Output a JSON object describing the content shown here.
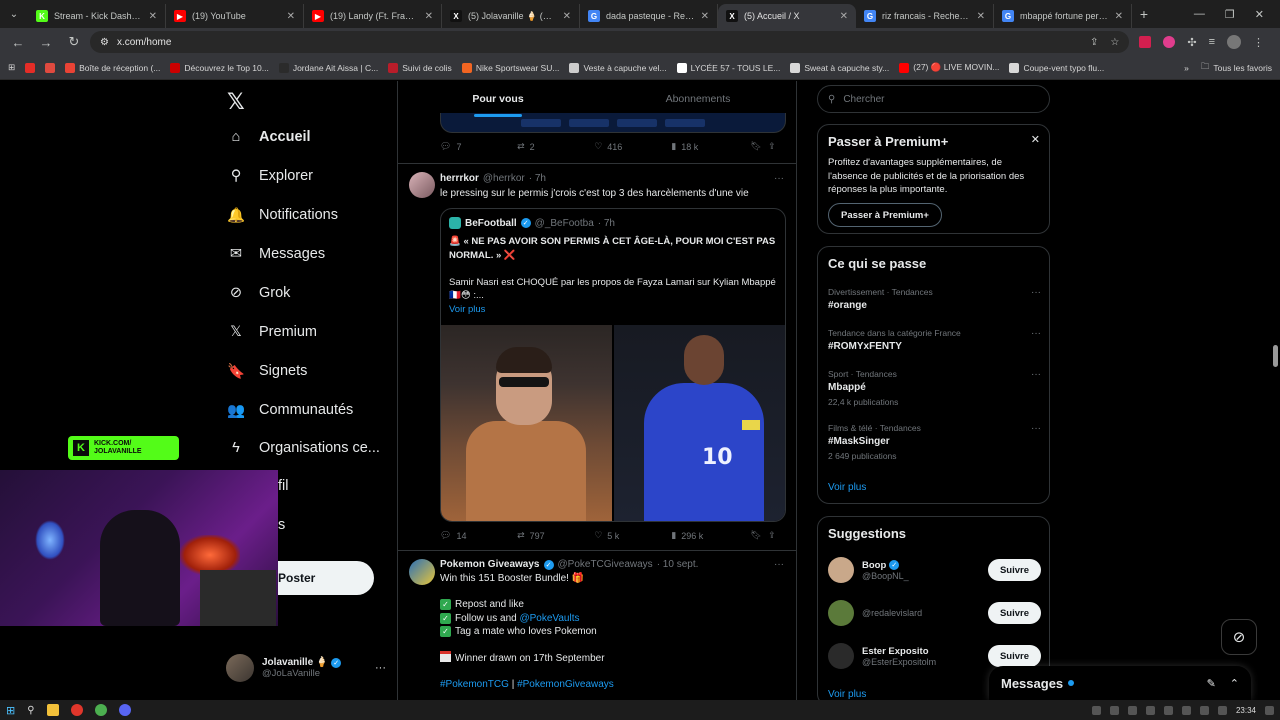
{
  "browser": {
    "tabs": [
      {
        "label": "Stream - Kick Dashboard",
        "fav": "K",
        "color": "#53fc18",
        "active": false
      },
      {
        "label": "(19) YouTube",
        "fav": "▶",
        "color": "#ff0000",
        "active": false
      },
      {
        "label": "(19) Landy (Ft. Franglish)",
        "fav": "▶",
        "color": "#ff0000",
        "active": false
      },
      {
        "label": "(5) Jolavanille 🍦 (@JoLaV",
        "fav": "X",
        "color": "#111111",
        "active": false
      },
      {
        "label": "dada pasteque - Recherch",
        "fav": "G",
        "color": "#4285f4",
        "active": false
      },
      {
        "label": "(5) Accueil / X",
        "fav": "X",
        "color": "#111111",
        "active": true
      },
      {
        "label": "riz francais - Recherche G",
        "fav": "G",
        "color": "#4285f4",
        "active": false
      },
      {
        "label": "mbappé fortune personn",
        "fav": "G",
        "color": "#4285f4",
        "active": false
      }
    ],
    "url": "x.com/home",
    "bookmarks": [
      {
        "label": "",
        "color": "#e52d27"
      },
      {
        "label": "",
        "color": "#e04a3f"
      },
      {
        "label": "Boîte de réception (...",
        "color": "#ea4335"
      },
      {
        "label": "Découvrez le Top 10...",
        "color": "#cc0000"
      },
      {
        "label": "Jordane Ait Aissa | C...",
        "color": "#2b2b2b"
      },
      {
        "label": "Suivi de colis",
        "color": "#b91d2a"
      },
      {
        "label": "Nike Sportswear SU...",
        "color": "#f26522"
      },
      {
        "label": "Veste à capuche vel...",
        "color": "#cccccc"
      },
      {
        "label": "LYCÉE 57 - TOUS LE...",
        "color": "#ffffff"
      },
      {
        "label": "Sweat à capuche sty...",
        "color": "#d8d8d8"
      },
      {
        "label": "(27) 🔴 LIVE MOVIN...",
        "color": "#ff0000"
      },
      {
        "label": "Coupe-vent typo flu...",
        "color": "#d8d8d8"
      }
    ],
    "bookmarks_all": "Tous les favoris"
  },
  "nav": {
    "items": [
      {
        "label": "Accueil",
        "icon": "home-icon",
        "glyph": "⌂",
        "bold": true,
        "badge": ""
      },
      {
        "label": "Explorer",
        "icon": "search-icon",
        "glyph": "⚲",
        "bold": false,
        "badge": ""
      },
      {
        "label": "Notifications",
        "icon": "bell-icon",
        "glyph": "🔔",
        "bold": false,
        "badge": "4"
      },
      {
        "label": "Messages",
        "icon": "mail-icon",
        "glyph": "✉",
        "bold": false,
        "badge": "1"
      },
      {
        "label": "Grok",
        "icon": "grok-icon",
        "glyph": "⊘",
        "bold": false,
        "badge": ""
      },
      {
        "label": "Premium",
        "icon": "x-logo-icon",
        "glyph": "𝕏",
        "bold": false,
        "badge": ""
      },
      {
        "label": "Signets",
        "icon": "bookmark-icon",
        "glyph": "🔖",
        "bold": false,
        "badge": ""
      },
      {
        "label": "Communautés",
        "icon": "communities-icon",
        "glyph": "👥",
        "bold": false,
        "badge": ""
      },
      {
        "label": "Organisations ce...",
        "icon": "lightning-icon",
        "glyph": "ϟ",
        "bold": false,
        "badge": ""
      },
      {
        "label": "fil",
        "icon": "profile-icon",
        "glyph": "",
        "bold": false,
        "badge": ""
      },
      {
        "label": "s",
        "icon": "more-icon",
        "glyph": "",
        "bold": false,
        "badge": ""
      }
    ],
    "post_label": "Poster",
    "user_name": "Jolavanille 🍦",
    "user_handle": "@JoLaVanille"
  },
  "kick_badge": {
    "line1": "KICK.COM/",
    "line2": "JOLAVANILLE"
  },
  "timeline": {
    "tabs": [
      "Pour vous",
      "Abonnements"
    ],
    "prev_actions": {
      "replies": "7",
      "reposts": "2",
      "likes": "416",
      "views": "18 k"
    },
    "tweet1": {
      "name": "herrrkor",
      "handle": "@herrkor",
      "time": "· 7h",
      "text": "le pressing sur le permis j'crois c'est top 3 des harcèlements d'une vie",
      "quote": {
        "name": "BeFootball",
        "handle": "@_BeFootba",
        "time": "· 7h",
        "line1": "🚨 « NE PAS AVOIR SON PERMIS À CET ÂGE-LÀ, POUR MOI C'EST PAS NORMAL. » ❌",
        "line2": "Samir Nasri est CHOQUÉ par les propos de Fayza Lamari sur Kylian Mbappé 🇫🇷😳 :...",
        "more": "Voir plus",
        "jersey_number": "10"
      },
      "actions": {
        "replies": "14",
        "reposts": "797",
        "likes": "5 k",
        "views": "296 k"
      }
    },
    "tweet2": {
      "name": "Pokemon Giveaways",
      "handle": "@PokeTCGiveaways",
      "time": "· 10 sept.",
      "title": "Win this 151 Booster Bundle! 🎁",
      "check1": "Repost and like",
      "check2_pre": "Follow us and ",
      "check2_link": "@PokeVaults",
      "check3": "Tag a mate who loves Pokemon",
      "winner": "Winner drawn on 17th September",
      "hashtag1": "#PokemonTCG",
      "hashtag_sep": " | ",
      "hashtag2": "#PokemonGiveaways"
    }
  },
  "right": {
    "search_placeholder": "Chercher",
    "premium": {
      "title": "Passer à Premium+",
      "text": "Profitez d'avantages supplémentaires, de l'absence de publicités et de la priorisation des réponses la plus importante.",
      "button": "Passer à Premium+"
    },
    "trends": {
      "title": "Ce qui se passe",
      "items": [
        {
          "meta": "Divertissement · Tendances",
          "topic": "#orange",
          "count": ""
        },
        {
          "meta": "Tendance dans la catégorie France",
          "topic": "#ROMYxFENTY",
          "count": ""
        },
        {
          "meta": "Sport · Tendances",
          "topic": "Mbappé",
          "count": "22,4 k publications"
        },
        {
          "meta": "Films & télé · Tendances",
          "topic": "#MaskSinger",
          "count": "2 649 publications"
        }
      ],
      "more": "Voir plus"
    },
    "suggestions": {
      "title": "Suggestions",
      "items": [
        {
          "name": "Boop",
          "handle": "@BoopNL_",
          "verified": true,
          "color": "#c9a88a"
        },
        {
          "name": "",
          "handle": "@redalevislard",
          "verified": false,
          "color": "#5b7a3a"
        },
        {
          "name": "Ester Exposito",
          "handle": "@EsterExpositolm",
          "verified": false,
          "color": "#2a2a2a"
        }
      ],
      "follow": "Suivre",
      "more": "Voir plus"
    }
  },
  "messages_drawer": {
    "title": "Messages"
  },
  "taskbar": {
    "time": "23:34"
  }
}
